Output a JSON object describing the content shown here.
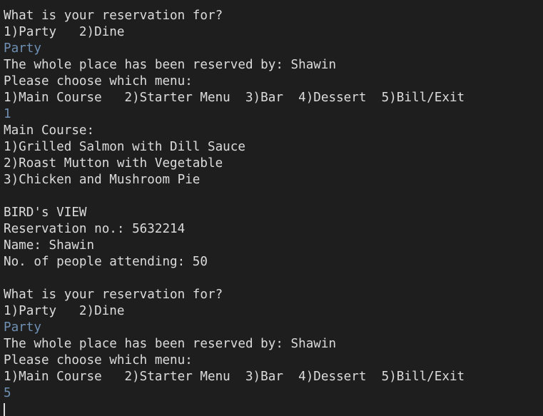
{
  "console": {
    "lines": [
      {
        "text": "What is your reservation for?",
        "kind": "output"
      },
      {
        "text": "1)Party   2)Dine",
        "kind": "output"
      },
      {
        "text": "Party",
        "kind": "input"
      },
      {
        "text": "The whole place has been reserved by: Shawin",
        "kind": "output"
      },
      {
        "text": "Please choose which menu:",
        "kind": "output"
      },
      {
        "text": "1)Main Course   2)Starter Menu  3)Bar  4)Dessert  5)Bill/Exit",
        "kind": "output"
      },
      {
        "text": "1",
        "kind": "input"
      },
      {
        "text": "Main Course:",
        "kind": "output"
      },
      {
        "text": "1)Grilled Salmon with Dill Sauce",
        "kind": "output"
      },
      {
        "text": "2)Roast Mutton with Vegetable",
        "kind": "output"
      },
      {
        "text": "3)Chicken and Mushroom Pie",
        "kind": "output"
      },
      {
        "text": "",
        "kind": "blank"
      },
      {
        "text": "BIRD's VIEW",
        "kind": "output"
      },
      {
        "text": "Reservation no.: 5632214",
        "kind": "output"
      },
      {
        "text": "Name: Shawin",
        "kind": "output"
      },
      {
        "text": "No. of people attending: 50",
        "kind": "output"
      },
      {
        "text": "",
        "kind": "blank"
      },
      {
        "text": "What is your reservation for?",
        "kind": "output"
      },
      {
        "text": "1)Party   2)Dine",
        "kind": "output"
      },
      {
        "text": "Party",
        "kind": "input"
      },
      {
        "text": "The whole place has been reserved by: Shawin",
        "kind": "output"
      },
      {
        "text": "Please choose which menu:",
        "kind": "output"
      },
      {
        "text": "1)Main Course   2)Starter Menu  3)Bar  4)Dessert  5)Bill/Exit",
        "kind": "output"
      },
      {
        "text": "5",
        "kind": "input"
      }
    ],
    "colors": {
      "background": "#1e1e1e",
      "output_text": "#dcdcdc",
      "input_text": "#6f8fb3"
    }
  }
}
